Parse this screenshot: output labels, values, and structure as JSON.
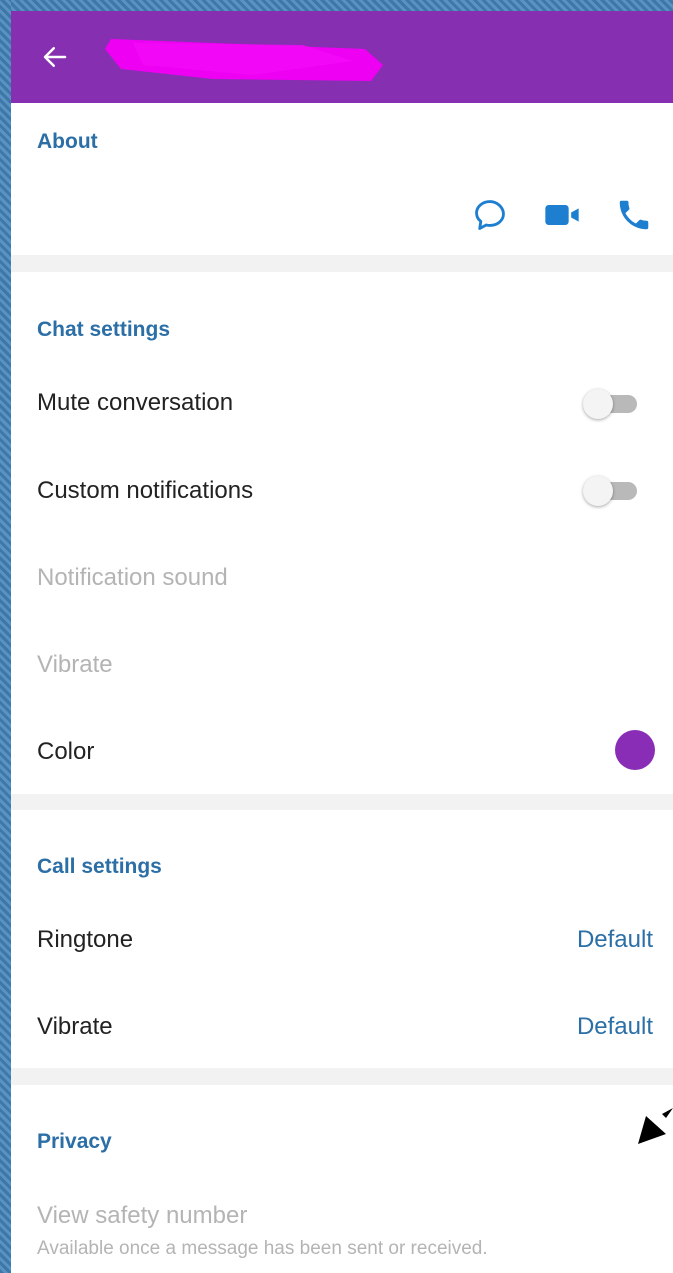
{
  "colors": {
    "appbar": "#862fb1",
    "accent": "#2b6fa6",
    "conversation_color": "#8a2db6",
    "redaction": "#ee00f2"
  },
  "appbar": {
    "back_icon": "arrow-left-icon"
  },
  "about": {
    "title": "About",
    "actions": [
      {
        "name": "message",
        "icon": "chat-bubble-icon"
      },
      {
        "name": "video-call",
        "icon": "video-camera-icon"
      },
      {
        "name": "voice-call",
        "icon": "phone-icon"
      }
    ]
  },
  "chat_settings": {
    "title": "Chat settings",
    "mute_conversation": {
      "label": "Mute conversation",
      "enabled": false
    },
    "custom_notifications": {
      "label": "Custom notifications",
      "enabled": false
    },
    "notification_sound": {
      "label": "Notification sound"
    },
    "vibrate": {
      "label": "Vibrate"
    },
    "color": {
      "label": "Color"
    }
  },
  "call_settings": {
    "title": "Call settings",
    "ringtone": {
      "label": "Ringtone",
      "value": "Default"
    },
    "vibrate": {
      "label": "Vibrate",
      "value": "Default"
    }
  },
  "privacy": {
    "title": "Privacy",
    "view_safety_number": {
      "label": "View safety number",
      "subtitle": "Available once a message has been sent or received."
    }
  }
}
